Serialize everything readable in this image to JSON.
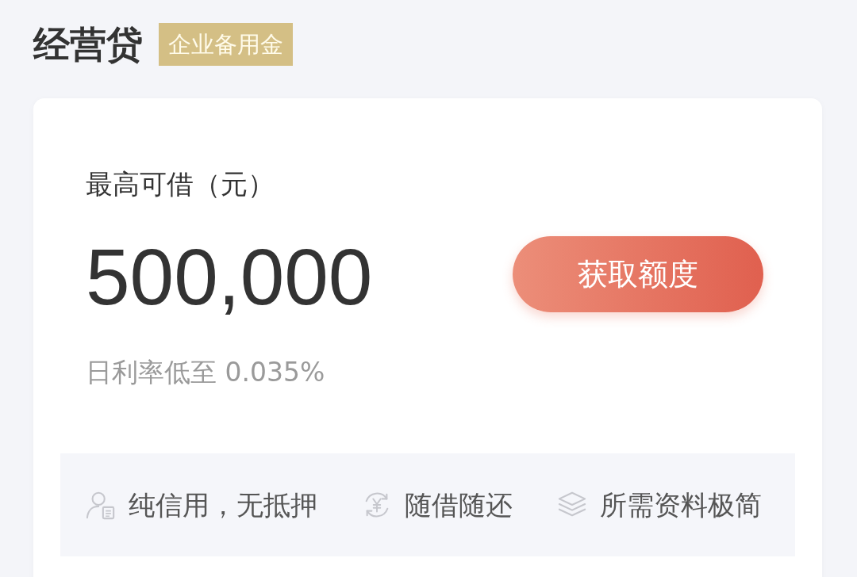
{
  "header": {
    "title": "经营贷",
    "tag": "企业备用金"
  },
  "card": {
    "limit_label": "最高可借（元）",
    "amount": "500,000",
    "button": "获取额度",
    "rate": "日利率低至 0.035%",
    "features": [
      {
        "kind": "credit",
        "label": "纯信用，无抵押"
      },
      {
        "kind": "repay",
        "label": "随借随还"
      },
      {
        "kind": "docs",
        "label": "所需资料极简"
      }
    ]
  }
}
